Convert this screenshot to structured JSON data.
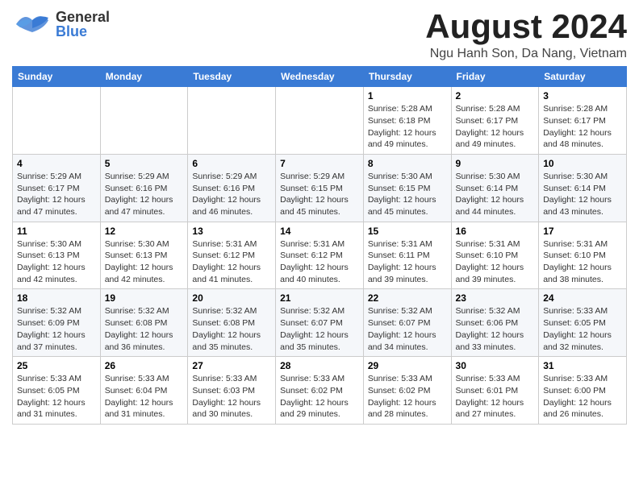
{
  "header": {
    "logo_general": "General",
    "logo_blue": "Blue",
    "month_title": "August 2024",
    "location": "Ngu Hanh Son, Da Nang, Vietnam"
  },
  "calendar": {
    "days_of_week": [
      "Sunday",
      "Monday",
      "Tuesday",
      "Wednesday",
      "Thursday",
      "Friday",
      "Saturday"
    ],
    "weeks": [
      [
        {
          "day": "",
          "info": ""
        },
        {
          "day": "",
          "info": ""
        },
        {
          "day": "",
          "info": ""
        },
        {
          "day": "",
          "info": ""
        },
        {
          "day": "1",
          "info": "Sunrise: 5:28 AM\nSunset: 6:18 PM\nDaylight: 12 hours\nand 49 minutes."
        },
        {
          "day": "2",
          "info": "Sunrise: 5:28 AM\nSunset: 6:17 PM\nDaylight: 12 hours\nand 49 minutes."
        },
        {
          "day": "3",
          "info": "Sunrise: 5:28 AM\nSunset: 6:17 PM\nDaylight: 12 hours\nand 48 minutes."
        }
      ],
      [
        {
          "day": "4",
          "info": "Sunrise: 5:29 AM\nSunset: 6:17 PM\nDaylight: 12 hours\nand 47 minutes."
        },
        {
          "day": "5",
          "info": "Sunrise: 5:29 AM\nSunset: 6:16 PM\nDaylight: 12 hours\nand 47 minutes."
        },
        {
          "day": "6",
          "info": "Sunrise: 5:29 AM\nSunset: 6:16 PM\nDaylight: 12 hours\nand 46 minutes."
        },
        {
          "day": "7",
          "info": "Sunrise: 5:29 AM\nSunset: 6:15 PM\nDaylight: 12 hours\nand 45 minutes."
        },
        {
          "day": "8",
          "info": "Sunrise: 5:30 AM\nSunset: 6:15 PM\nDaylight: 12 hours\nand 45 minutes."
        },
        {
          "day": "9",
          "info": "Sunrise: 5:30 AM\nSunset: 6:14 PM\nDaylight: 12 hours\nand 44 minutes."
        },
        {
          "day": "10",
          "info": "Sunrise: 5:30 AM\nSunset: 6:14 PM\nDaylight: 12 hours\nand 43 minutes."
        }
      ],
      [
        {
          "day": "11",
          "info": "Sunrise: 5:30 AM\nSunset: 6:13 PM\nDaylight: 12 hours\nand 42 minutes."
        },
        {
          "day": "12",
          "info": "Sunrise: 5:30 AM\nSunset: 6:13 PM\nDaylight: 12 hours\nand 42 minutes."
        },
        {
          "day": "13",
          "info": "Sunrise: 5:31 AM\nSunset: 6:12 PM\nDaylight: 12 hours\nand 41 minutes."
        },
        {
          "day": "14",
          "info": "Sunrise: 5:31 AM\nSunset: 6:12 PM\nDaylight: 12 hours\nand 40 minutes."
        },
        {
          "day": "15",
          "info": "Sunrise: 5:31 AM\nSunset: 6:11 PM\nDaylight: 12 hours\nand 39 minutes."
        },
        {
          "day": "16",
          "info": "Sunrise: 5:31 AM\nSunset: 6:10 PM\nDaylight: 12 hours\nand 39 minutes."
        },
        {
          "day": "17",
          "info": "Sunrise: 5:31 AM\nSunset: 6:10 PM\nDaylight: 12 hours\nand 38 minutes."
        }
      ],
      [
        {
          "day": "18",
          "info": "Sunrise: 5:32 AM\nSunset: 6:09 PM\nDaylight: 12 hours\nand 37 minutes."
        },
        {
          "day": "19",
          "info": "Sunrise: 5:32 AM\nSunset: 6:08 PM\nDaylight: 12 hours\nand 36 minutes."
        },
        {
          "day": "20",
          "info": "Sunrise: 5:32 AM\nSunset: 6:08 PM\nDaylight: 12 hours\nand 35 minutes."
        },
        {
          "day": "21",
          "info": "Sunrise: 5:32 AM\nSunset: 6:07 PM\nDaylight: 12 hours\nand 35 minutes."
        },
        {
          "day": "22",
          "info": "Sunrise: 5:32 AM\nSunset: 6:07 PM\nDaylight: 12 hours\nand 34 minutes."
        },
        {
          "day": "23",
          "info": "Sunrise: 5:32 AM\nSunset: 6:06 PM\nDaylight: 12 hours\nand 33 minutes."
        },
        {
          "day": "24",
          "info": "Sunrise: 5:33 AM\nSunset: 6:05 PM\nDaylight: 12 hours\nand 32 minutes."
        }
      ],
      [
        {
          "day": "25",
          "info": "Sunrise: 5:33 AM\nSunset: 6:05 PM\nDaylight: 12 hours\nand 31 minutes."
        },
        {
          "day": "26",
          "info": "Sunrise: 5:33 AM\nSunset: 6:04 PM\nDaylight: 12 hours\nand 31 minutes."
        },
        {
          "day": "27",
          "info": "Sunrise: 5:33 AM\nSunset: 6:03 PM\nDaylight: 12 hours\nand 30 minutes."
        },
        {
          "day": "28",
          "info": "Sunrise: 5:33 AM\nSunset: 6:02 PM\nDaylight: 12 hours\nand 29 minutes."
        },
        {
          "day": "29",
          "info": "Sunrise: 5:33 AM\nSunset: 6:02 PM\nDaylight: 12 hours\nand 28 minutes."
        },
        {
          "day": "30",
          "info": "Sunrise: 5:33 AM\nSunset: 6:01 PM\nDaylight: 12 hours\nand 27 minutes."
        },
        {
          "day": "31",
          "info": "Sunrise: 5:33 AM\nSunset: 6:00 PM\nDaylight: 12 hours\nand 26 minutes."
        }
      ]
    ]
  }
}
